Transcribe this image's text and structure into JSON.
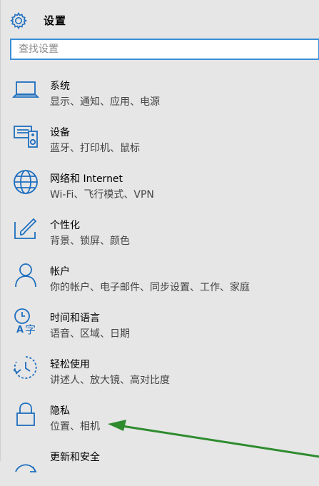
{
  "header": {
    "title": "设置",
    "icon": "gear-icon"
  },
  "search": {
    "placeholder": "查找设置"
  },
  "accent_color": "#1f6fbf",
  "items": [
    {
      "name": "系统",
      "desc": "显示、通知、应用、电源",
      "icon": "laptop-icon"
    },
    {
      "name": "设备",
      "desc": "蓝牙、打印机、鼠标",
      "icon": "devices-icon"
    },
    {
      "name": "网络和 Internet",
      "desc": "Wi-Fi、飞行模式、VPN",
      "icon": "globe-icon"
    },
    {
      "name": "个性化",
      "desc": "背景、锁屏、颜色",
      "icon": "paint-brush-icon"
    },
    {
      "name": "帐户",
      "desc": "你的帐户、电子邮件、同步设置、工作、家庭",
      "icon": "person-icon"
    },
    {
      "name": "时间和语言",
      "desc": "语音、区域、日期",
      "icon": "time-language-icon"
    },
    {
      "name": "轻松使用",
      "desc": "讲述人、放大镜、高对比度",
      "icon": "ease-of-access-icon"
    },
    {
      "name": "隐私",
      "desc": "位置、相机",
      "icon": "lock-icon"
    },
    {
      "name": "更新和安全",
      "desc": "",
      "icon": "update-icon"
    }
  ],
  "annotation": {
    "type": "green-arrow",
    "points_to": "隐私",
    "color": "#2e8b2e"
  }
}
